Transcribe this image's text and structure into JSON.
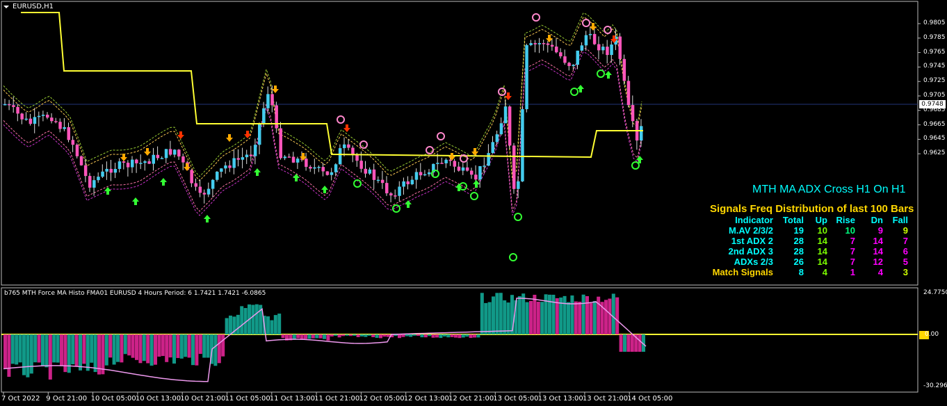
{
  "window": {
    "symbol": "EURUSD,H1"
  },
  "indicator_title": "b765 MTH Force MA Histo FMA01 EURUSD 4 Hours Period: 6  1.7421 1.7421 -6.0865",
  "price_axis": [
    "0.9805",
    "0.9785",
    "0.9765",
    "0.9745",
    "0.9725",
    "0.9705",
    "0.9685",
    "0.9665",
    "0.9645",
    "0.9625"
  ],
  "current_price": "0.9748",
  "indicator_axis": {
    "top": "24.7750",
    "zero": "0.00",
    "bottom": "-30.2965"
  },
  "time_axis": [
    "7 Oct 2022",
    "9 Oct 21:00",
    "10 Oct 05:00",
    "10 Oct 13:00",
    "10 Oct 21:00",
    "11 Oct 05:00",
    "11 Oct 13:00",
    "11 Oct 21:00",
    "12 Oct 05:00",
    "12 Oct 13:00",
    "12 Oct 21:00",
    "13 Oct 05:00",
    "13 Oct 13:00",
    "13 Oct 21:00",
    "14 Oct 05:00"
  ],
  "panel": {
    "title": "MTH MA ADX Cross H1 On H1",
    "subtitle": "Signals Freq Distribution of last 100 Bars",
    "headers": [
      "Indicator",
      "Total",
      "Up",
      "Rise",
      "Dn",
      "Fall"
    ],
    "rows": [
      {
        "name": "M.AV 2/3/2",
        "total": "19",
        "up": "10",
        "rise": "10",
        "dn": "9",
        "fall": "9"
      },
      {
        "name": "1st ADX 2",
        "total": "28",
        "up": "14",
        "rise": "7",
        "dn": "14",
        "fall": "7"
      },
      {
        "name": "2nd ADX 3",
        "total": "28",
        "up": "14",
        "rise": "7",
        "dn": "14",
        "fall": "6"
      },
      {
        "name": "ADXs 2/3",
        "total": "26",
        "up": "14",
        "rise": "7",
        "dn": "12",
        "fall": "5"
      },
      {
        "name": "Match Signals",
        "total": "8",
        "up": "4",
        "rise": "1",
        "dn": "4",
        "fall": "3"
      }
    ]
  },
  "colors": {
    "bull": "#44ccee",
    "bear": "#ff55bb",
    "ma": "#ffff33",
    "signal_up": "#33ff33",
    "signal_dn": "#ff3300",
    "histo_pos": "#119988",
    "histo_neg": "#cc2288"
  }
}
